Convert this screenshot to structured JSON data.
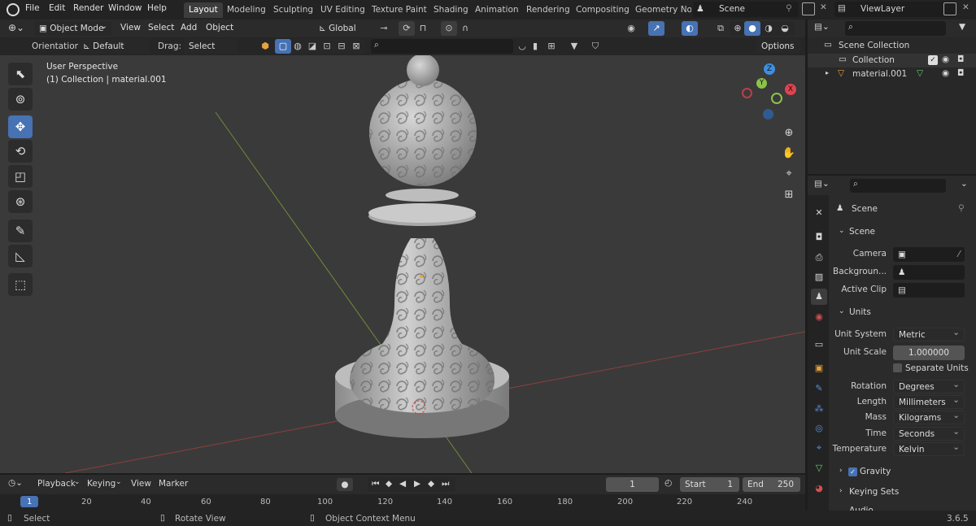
{
  "menu": [
    "File",
    "Edit",
    "Render",
    "Window",
    "Help"
  ],
  "workspaces": [
    "Layout",
    "Modeling",
    "Sculpting",
    "UV Editing",
    "Texture Paint",
    "Shading",
    "Animation",
    "Rendering",
    "Compositing",
    "Geometry Noc"
  ],
  "scene_name": "Scene",
  "view_layer": "ViewLayer",
  "header": {
    "mode": "Object Mode",
    "view": "View",
    "select": "Select",
    "add": "Add",
    "object": "Object",
    "transform_orientation": "Global"
  },
  "toolsettings": {
    "orientation_label": "Orientation:",
    "orientation_value": "Default",
    "drag_label": "Drag:",
    "drag_value": "Select Box",
    "options": "Options"
  },
  "viewport": {
    "perspective": "User Perspective",
    "collection_info": "(1) Collection | material.001"
  },
  "gizmo": {
    "z": "Z",
    "y": "Y",
    "x": "X"
  },
  "outliner": {
    "scene_collection": "Scene Collection",
    "collection": "Collection",
    "object": "material.001"
  },
  "properties": {
    "context": "Scene",
    "scene_panel": "Scene",
    "camera_label": "Camera",
    "background_label": "Backgroun...",
    "active_clip_label": "Active Clip",
    "units_panel": "Units",
    "unit_system_label": "Unit System",
    "unit_system": "Metric",
    "unit_scale_label": "Unit Scale",
    "unit_scale": "1.000000",
    "separate_units": "Separate Units",
    "rotation_label": "Rotation",
    "rotation": "Degrees",
    "length_label": "Length",
    "length": "Millimeters",
    "mass_label": "Mass",
    "mass": "Kilograms",
    "time_label": "Time",
    "time": "Seconds",
    "temperature_label": "Temperature",
    "temperature": "Kelvin",
    "gravity": "Gravity",
    "keying_sets": "Keying Sets",
    "audio": "Audio"
  },
  "timeline": {
    "playback": "Playback",
    "keying": "Keying",
    "view": "View",
    "marker": "Marker",
    "current_frame": "1",
    "start_label": "Start",
    "start": "1",
    "end_label": "End",
    "end": "250",
    "ticks": [
      "1",
      "20",
      "40",
      "60",
      "80",
      "100",
      "120",
      "140",
      "160",
      "180",
      "200",
      "220",
      "240"
    ]
  },
  "statusbar": {
    "select": "Select",
    "rotate": "Rotate View",
    "context_menu": "Object Context Menu",
    "version": "3.6.5"
  },
  "colors": {
    "accent": "#4772b3",
    "x_axis": "#e0434f",
    "y_axis": "#8bc34a",
    "z_axis": "#3d8fe0"
  }
}
